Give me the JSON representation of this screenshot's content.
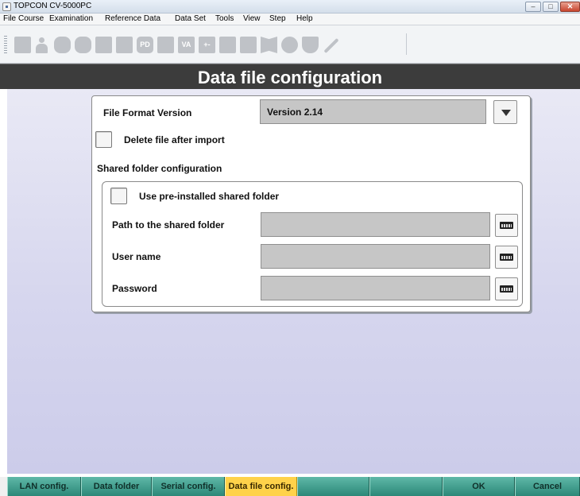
{
  "window": {
    "title": "TOPCON CV-5000PC"
  },
  "menubar": {
    "items": [
      {
        "label": "File"
      },
      {
        "label": "Course"
      },
      {
        "label": "Examination"
      },
      {
        "label": "Reference Data"
      },
      {
        "label": "Data Set"
      },
      {
        "label": "Tools"
      },
      {
        "label": "View"
      },
      {
        "label": "Step"
      },
      {
        "label": "Help"
      }
    ]
  },
  "toolbar": {
    "buttons": [
      {
        "icon": "device-icon"
      },
      {
        "icon": "patient-icon"
      },
      {
        "icon": "glasses-icon"
      },
      {
        "icon": "glasses-alt-icon"
      },
      {
        "icon": "lensmeter-icon"
      },
      {
        "icon": "card-icon"
      },
      {
        "icon": "pd-icon",
        "text": "PD"
      },
      {
        "icon": "screen-icon"
      },
      {
        "icon": "va-icon",
        "text": "VA"
      },
      {
        "icon": "plus-minus-icon",
        "text": "+-"
      },
      {
        "icon": "chart-icon"
      },
      {
        "icon": "chart-alt-icon"
      },
      {
        "icon": "book-icon"
      },
      {
        "icon": "circle-icon"
      },
      {
        "icon": "shield-icon"
      },
      {
        "icon": "wrench-icon"
      }
    ],
    "color": "#bfc2c7"
  },
  "header": {
    "title": "Data file configuration",
    "background": "#3c3c3c"
  },
  "form": {
    "file_format_label": "File Format Version",
    "file_format_value": "Version 2.14",
    "delete_file_label": "Delete file after import",
    "delete_file_checked": false,
    "shared_folder_heading": "Shared folder configuration",
    "use_preinstalled_label": "Use pre-installed shared folder",
    "use_preinstalled_checked": false,
    "path_label": "Path to the shared folder",
    "path_value": "",
    "username_label": "User name",
    "username_value": "",
    "password_label": "Password",
    "password_value": ""
  },
  "tabs": [
    {
      "label": "LAN config.",
      "active": false
    },
    {
      "label": "Data folder",
      "active": false
    },
    {
      "label": "Serial config.",
      "active": false
    },
    {
      "label": "Data file config.",
      "active": true
    },
    {
      "label": "",
      "active": false
    },
    {
      "label": "",
      "active": false
    },
    {
      "label": "OK",
      "active": false
    },
    {
      "label": "Cancel",
      "active": false
    }
  ],
  "colors": {
    "tab_active": "#ffd24a",
    "tab_inactive": "#3d9e8c",
    "content_bg": "#d6d6ee"
  }
}
